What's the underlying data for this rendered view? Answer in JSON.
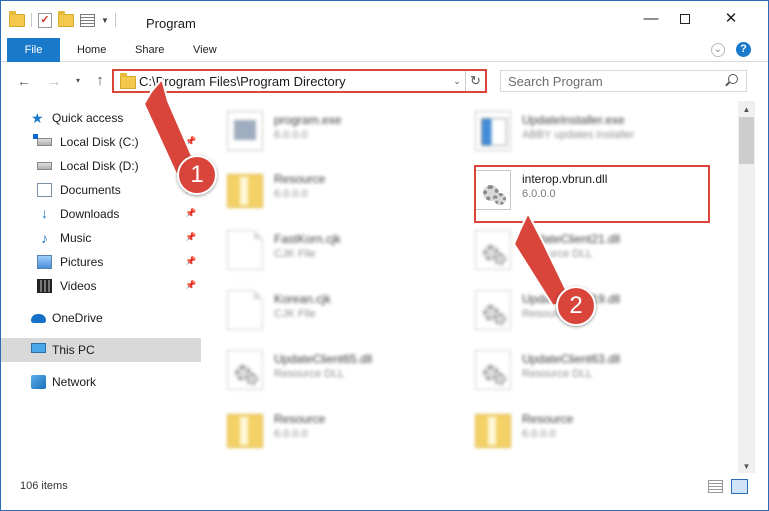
{
  "window": {
    "title": "Program",
    "minimize_glyph": "—",
    "close_glyph": "✕"
  },
  "ribbon": {
    "tabs": [
      {
        "label": "File"
      },
      {
        "label": "Home"
      },
      {
        "label": "Share"
      },
      {
        "label": "View"
      }
    ],
    "expand_glyph": "⌄",
    "help_glyph": "?"
  },
  "navigation": {
    "back_glyph": "←",
    "forward_glyph": "→",
    "recent_glyph": "▾",
    "up_glyph": "↑"
  },
  "address": {
    "path": "C:\\Program Files\\Program Directory",
    "dropdown_glyph": "⌄",
    "refresh_glyph": "↻"
  },
  "search": {
    "placeholder": "Search Program"
  },
  "sidebar": {
    "items": [
      {
        "label": "Quick access",
        "icon": "star-icon"
      },
      {
        "label": "Local Disk (C:)",
        "icon": "drive-icon",
        "pinned": true
      },
      {
        "label": "Local Disk (D:)",
        "icon": "drive-icon"
      },
      {
        "label": "Documents",
        "icon": "documents-icon",
        "pinned": true
      },
      {
        "label": "Downloads",
        "icon": "downloads-icon",
        "pinned": true
      },
      {
        "label": "Music",
        "icon": "music-icon",
        "pinned": true
      },
      {
        "label": "Pictures",
        "icon": "pictures-icon",
        "pinned": true
      },
      {
        "label": "Videos",
        "icon": "videos-icon",
        "pinned": true
      },
      {
        "label": "OneDrive",
        "icon": "onedrive-icon"
      },
      {
        "label": "This PC",
        "icon": "pc-icon",
        "selected": true
      },
      {
        "label": "Network",
        "icon": "network-icon"
      }
    ],
    "pin_glyph": "📌"
  },
  "files": [
    {
      "name": "program.exe",
      "sub": "6.0.0.0",
      "icon": "exe-icon"
    },
    {
      "name": "UpdateInstaller.exe",
      "sub": "ABBY updates installer",
      "icon": "installer-icon"
    },
    {
      "name": "Resource",
      "sub": "6.0.0.0",
      "icon": "folder-icon"
    },
    {
      "name": "interop.vbrun.dll",
      "sub": "6.0.0.0",
      "icon": "dll-icon"
    },
    {
      "name": "FastKorn.cjk",
      "sub": "CJK File",
      "icon": "document-icon"
    },
    {
      "name": "UpdateClient21.dll",
      "sub": "Resource DLL",
      "icon": "dll-icon"
    },
    {
      "name": "Korean.cjk",
      "sub": "CJK File",
      "icon": "document-icon"
    },
    {
      "name": "UpdateClient19.dll",
      "sub": "Resource DLL",
      "icon": "dll-icon"
    },
    {
      "name": "UpdateClient65.dll",
      "sub": "Resource DLL",
      "icon": "dll-icon"
    },
    {
      "name": "UpdateClient63.dll",
      "sub": "Resource DLL",
      "icon": "dll-icon"
    },
    {
      "name": "Resource",
      "sub": "6.0.0.0",
      "icon": "folder-icon"
    },
    {
      "name": "Resource",
      "sub": "6.0.0.0",
      "icon": "folder-icon"
    }
  ],
  "status": {
    "item_count": "106 items"
  },
  "annotations": {
    "step1": "1",
    "step2": "2",
    "color": "#d9453a"
  }
}
